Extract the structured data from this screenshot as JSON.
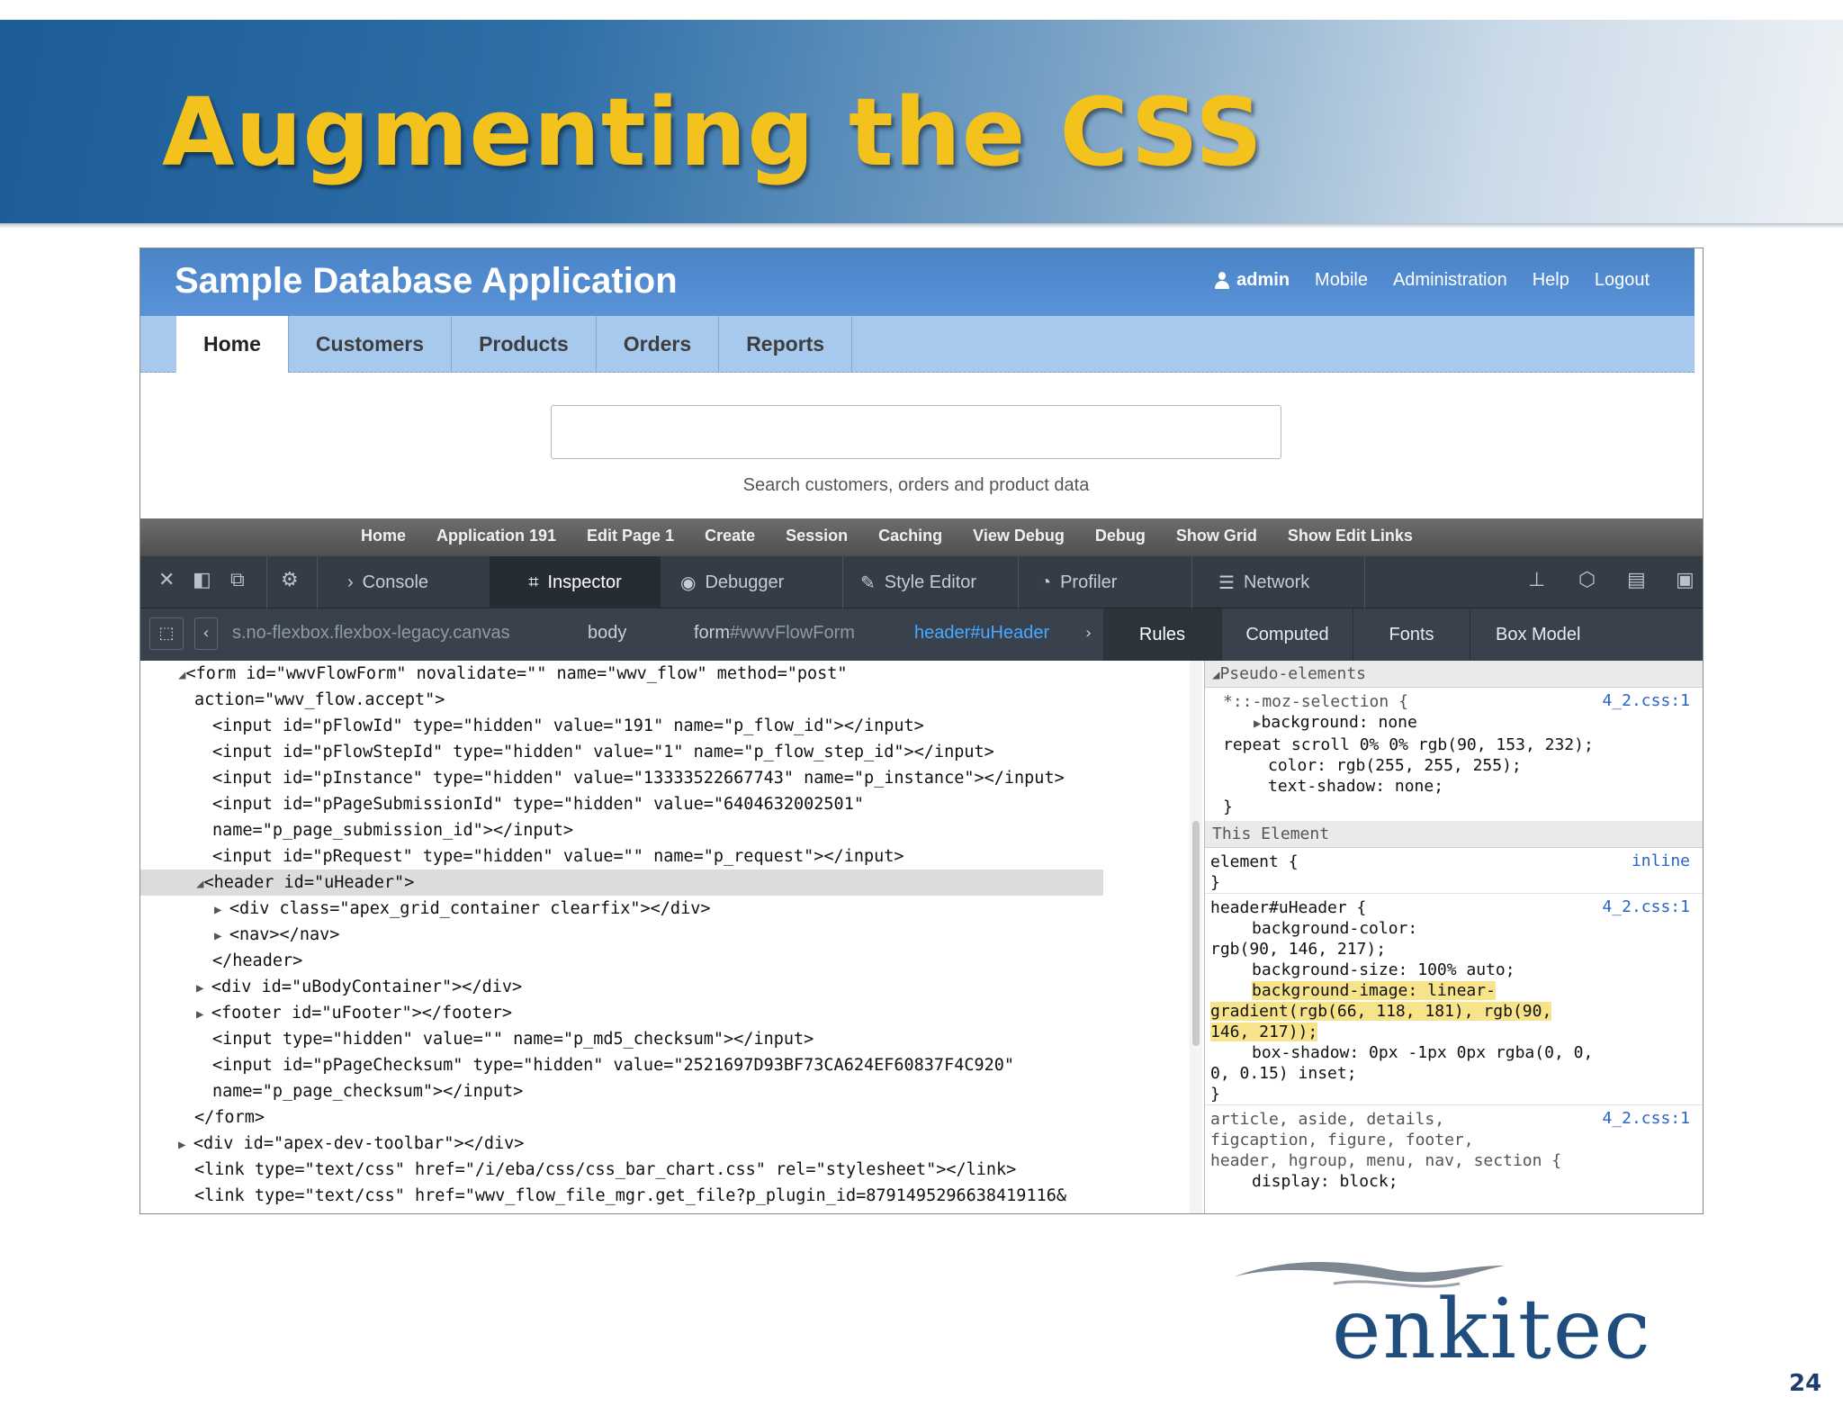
{
  "slide": {
    "title": "Augmenting the CSS",
    "page_number": "24",
    "logo_text": "enkitec"
  },
  "app": {
    "title": "Sample Database Application",
    "nav": {
      "user": "admin",
      "mobile": "Mobile",
      "administration": "Administration",
      "help": "Help",
      "logout": "Logout"
    },
    "tabs": [
      "Home",
      "Customers",
      "Products",
      "Orders",
      "Reports"
    ],
    "search_hint": "Search customers, orders and product data",
    "devbar": [
      "Home",
      "Application 191",
      "Edit Page 1",
      "Create",
      "Session",
      "Caching",
      "View Debug",
      "Debug",
      "Show Grid",
      "Show Edit Links"
    ]
  },
  "devtools": {
    "tabs": {
      "console": "Console",
      "inspector": "Inspector",
      "debugger": "Debugger",
      "style_editor": "Style Editor",
      "profiler": "Profiler",
      "network": "Network"
    },
    "breadcrumbs": {
      "c1": "s.no-flexbox.flexbox-legacy.canvas",
      "c2": "body",
      "c3_tag": "form",
      "c3_id": "#wwvFlowForm",
      "c4_tag": "header",
      "c4_id": "#uHeader"
    },
    "side_tabs": [
      "Rules",
      "Computed",
      "Fonts",
      "Box Model"
    ],
    "markup": [
      "<form id=\"wwvFlowForm\" novalidate=\"\" name=\"wwv_flow\" method=\"post\"",
      "action=\"wwv_flow.accept\">",
      "<input id=\"pFlowId\" type=\"hidden\" value=\"191\" name=\"p_flow_id\"></input>",
      "<input id=\"pFlowStepId\" type=\"hidden\" value=\"1\" name=\"p_flow_step_id\"></input>",
      "<input id=\"pInstance\" type=\"hidden\" value=\"13333522667743\" name=\"p_instance\"></input>",
      "<input id=\"pPageSubmissionId\" type=\"hidden\" value=\"6404632002501\"",
      "name=\"p_page_submission_id\"></input>",
      "<input id=\"pRequest\" type=\"hidden\" value=\"\" name=\"p_request\"></input>",
      "<header id=\"uHeader\">",
      "<div class=\"apex_grid_container clearfix\"></div>",
      "<nav></nav>",
      "</header>",
      "<div id=\"uBodyContainer\"></div>",
      "<footer id=\"uFooter\"></footer>",
      "<input type=\"hidden\" value=\"\" name=\"p_md5_checksum\"></input>",
      "<input id=\"pPageChecksum\" type=\"hidden\" value=\"2521697D93BF73CA624EF60837F4C920\"",
      "name=\"p_page_checksum\"></input>",
      "</form>",
      "<div id=\"apex-dev-toolbar\"></div>",
      "<link type=\"text/css\" href=\"/i/eba/css/css_bar_chart.css\" rel=\"stylesheet\"></link>",
      "<link type=\"text/css\" href=\"wwv_flow_file_mgr.get_file?p_plugin_id=8791495296638419116&"
    ],
    "rules": {
      "pseudo_header": "Pseudo-elements",
      "pseudo": [
        "*::-moz-selection {",
        "background: none",
        "repeat scroll 0% 0% rgb(90, 153, 232);",
        "color: rgb(255, 255, 255);",
        "text-shadow: none;",
        "}"
      ],
      "this_element": "This Element",
      "element_rule": [
        "element {",
        "}"
      ],
      "inline": "inline",
      "source": "4_2.css:1",
      "header_rule": [
        "header#uHeader {",
        "background-color:",
        "rgb(90, 146, 217);",
        "background-size: 100% auto;",
        "background-image: linear-",
        "gradient(rgb(66, 118, 181), rgb(90,",
        "146, 217));",
        "box-shadow: 0px -1px 0px rgba(0, 0,",
        "0, 0.15) inset;",
        "}"
      ],
      "article_rule": [
        "article, aside, details,",
        "figcaption, figure, footer,",
        "header, hgroup, menu, nav, section {",
        "display: block;"
      ]
    }
  }
}
